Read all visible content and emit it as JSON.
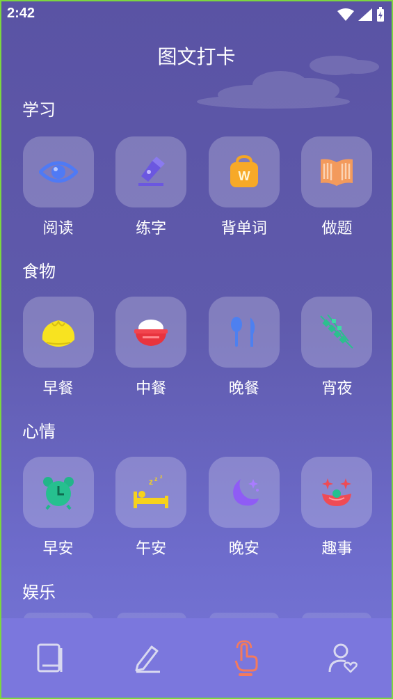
{
  "status": {
    "time": "2:42"
  },
  "title": "图文打卡",
  "sections": [
    {
      "title": "学习",
      "color": "#3a9bf0",
      "items": [
        {
          "label": "阅读",
          "icon": "eye-icon"
        },
        {
          "label": "练字",
          "icon": "pen-nib-icon"
        },
        {
          "label": "背单词",
          "icon": "bag-w-icon"
        },
        {
          "label": "做题",
          "icon": "open-book-icon"
        }
      ]
    },
    {
      "title": "食物",
      "color": "#e8c326",
      "items": [
        {
          "label": "早餐",
          "icon": "bun-icon"
        },
        {
          "label": "中餐",
          "icon": "rice-bowl-icon"
        },
        {
          "label": "晚餐",
          "icon": "spoon-knife-icon"
        },
        {
          "label": "宵夜",
          "icon": "skewer-icon"
        }
      ]
    },
    {
      "title": "心情",
      "color": "#ef6a5a",
      "items": [
        {
          "label": "早安",
          "icon": "alarm-clock-icon"
        },
        {
          "label": "午安",
          "icon": "bed-sleep-icon"
        },
        {
          "label": "晚安",
          "icon": "moon-icon"
        },
        {
          "label": "趣事",
          "icon": "clown-face-icon"
        }
      ]
    },
    {
      "title": "娱乐",
      "color": "#2fc5a3",
      "items": []
    }
  ],
  "nav": [
    {
      "name": "book",
      "active": false
    },
    {
      "name": "edit",
      "active": false
    },
    {
      "name": "checkin",
      "active": true
    },
    {
      "name": "profile",
      "active": false
    }
  ]
}
